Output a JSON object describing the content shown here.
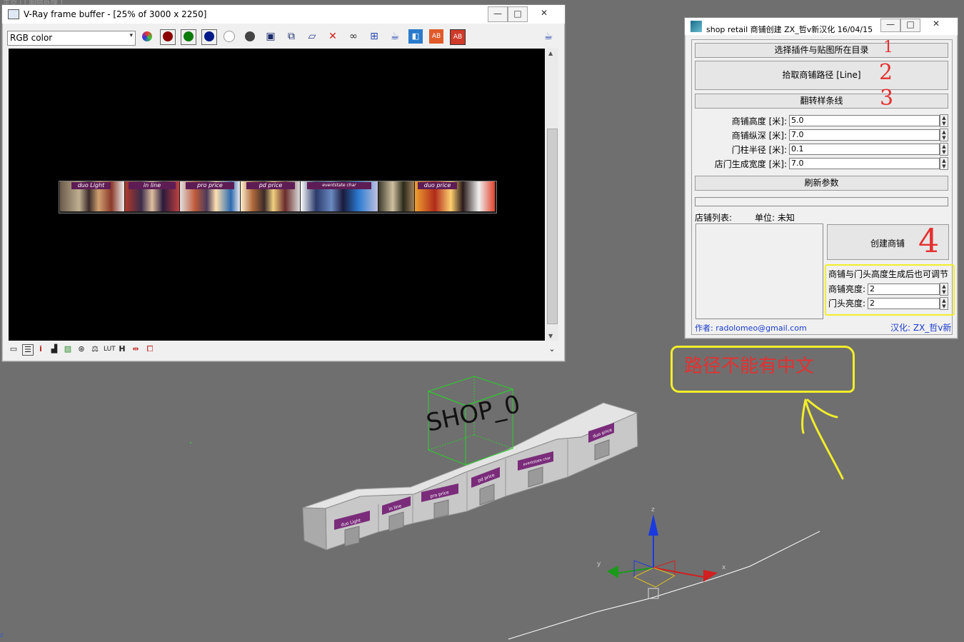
{
  "vray": {
    "title": "V-Ray frame buffer - [25% of 3000 x 2250]",
    "channel": "RGB color",
    "minimize": "—",
    "maximize": "□",
    "close": "✕",
    "filmstrip_labels": [
      "duo Light",
      "in line",
      "pro price",
      "pd price",
      "eventstate char",
      "duo price"
    ]
  },
  "shop_panel": {
    "title": "shop retail 商铺创建  ZX_哲v新汉化 16/04/15",
    "btn_select_dir": "选择插件与贴图所在目录",
    "btn_pick_path": "拾取商铺路径 [Line]",
    "btn_flip": "翻转样条线",
    "params": [
      {
        "label": "商铺高度 [米]:",
        "value": "5.0"
      },
      {
        "label": "商铺纵深 [米]:",
        "value": "7.0"
      },
      {
        "label": "门柱半径 [米]:",
        "value": "0.1"
      },
      {
        "label": "店门生成宽度 [米]:",
        "value": "7.0"
      }
    ],
    "btn_refresh": "刷新参数",
    "list_label": "店铺列表:",
    "unit_label": "单位: 未知",
    "btn_create": "创建商铺",
    "adjust_note": "商铺与门头高度生成后也可调节",
    "shop_height_label": "商铺亮度:",
    "shop_height_value": "2",
    "door_height_label": "门头亮度:",
    "door_height_value": "2",
    "author": "作者: radolomeo@gmail.com",
    "localizer": "汉化: ZX_哲v新"
  },
  "annotations": {
    "step1": "1",
    "step2": "2",
    "step3": "3",
    "step4": "4",
    "path_warning": "路径不能有中文"
  },
  "viewport": {
    "top_left_text": "正交 | [ 明暗处理 ]",
    "shop_label": "SHOP_0",
    "gizmo_x": "x",
    "gizmo_y": "y",
    "gizmo_z": "z",
    "facade_labels": [
      "duo Light",
      "in line",
      "pro price",
      "pd price",
      "eventstate char",
      "duo price"
    ]
  },
  "colors": {
    "annotation_red": "#e53030",
    "highlight_yellow": "#f2ee2a",
    "link_blue": "#1a3ccc",
    "signage_purple": "#7a2c7a"
  }
}
